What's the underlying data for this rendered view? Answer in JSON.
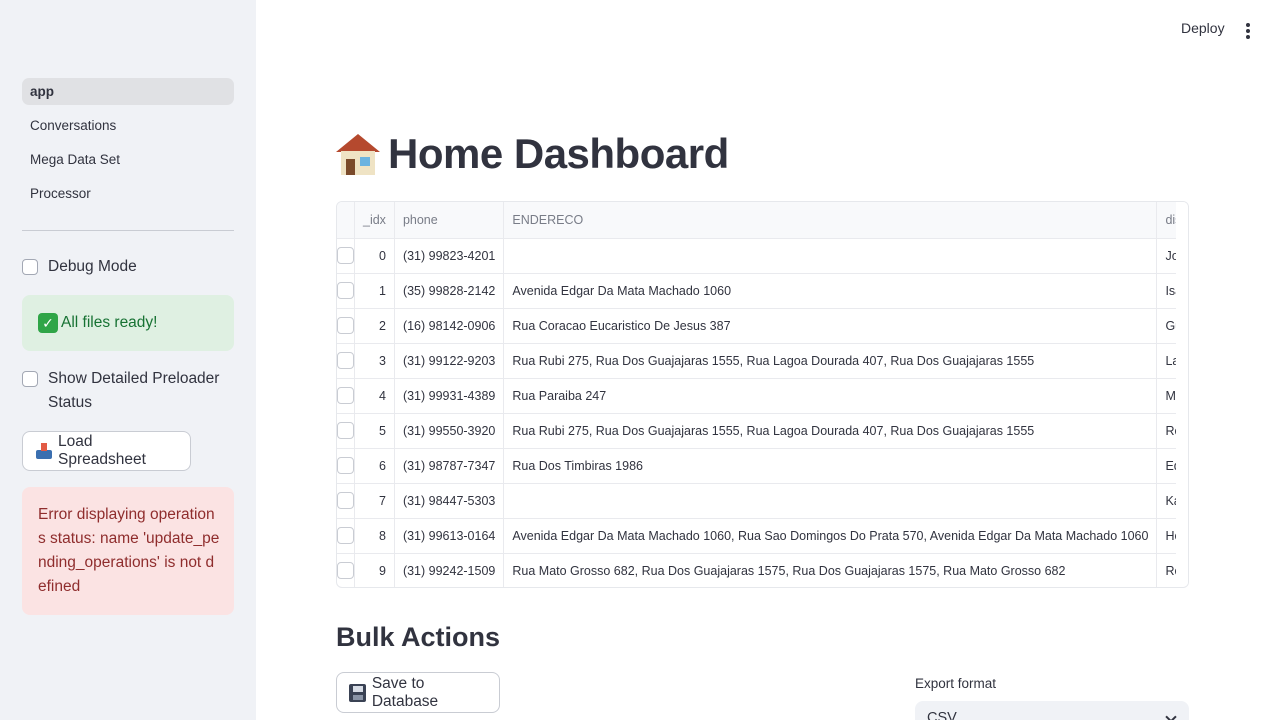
{
  "sidebar": {
    "nav": [
      {
        "label": "app",
        "active": true
      },
      {
        "label": "Conversations",
        "active": false
      },
      {
        "label": "Mega Data Set",
        "active": false
      },
      {
        "label": "Processor",
        "active": false
      }
    ],
    "debug_label": "Debug Mode",
    "success_text": "All files ready!",
    "success_icon": "check-mark-icon",
    "preloader_label": "Show Detailed Preloader Status",
    "load_button": "Load Spreadsheet",
    "load_icon": "inbox-tray-icon",
    "error_text": "Error displaying operations status: name 'update_pending_operations' is not defined"
  },
  "header": {
    "deploy": "Deploy",
    "menu_icon": "kebab-menu-icon"
  },
  "main": {
    "title": "Home Dashboard",
    "title_icon": "house-icon",
    "table": {
      "columns": [
        "_idx",
        "phone",
        "ENDERECO",
        "display_name"
      ],
      "rows": [
        {
          "idx": "0",
          "phone": "(31) 99823-4201",
          "endereco": "",
          "name": "João Ribas"
        },
        {
          "idx": "1",
          "phone": "(35) 99828-2142",
          "endereco": "Avenida Edgar Da Mata Machado 1060",
          "name": "Isabella Padua"
        },
        {
          "idx": "2",
          "phone": "(16) 98142-0906",
          "endereco": "Rua Coracao Eucaristico De Jesus 387",
          "name": "Guilherme Bustamante"
        },
        {
          "idx": "3",
          "phone": "(31) 99122-9203",
          "endereco": "Rua Rubi 275, Rua Dos Guajajaras 1555, Rua Lagoa Dourada 407, Rua Dos Guajajaras 1555",
          "name": "Laura Baldoni"
        },
        {
          "idx": "4",
          "phone": "(31) 99931-4389",
          "endereco": "Rua Paraiba 247",
          "name": "Moacir"
        },
        {
          "idx": "5",
          "phone": "(31) 99550-3920",
          "endereco": "Rua Rubi 275, Rua Dos Guajajaras 1555, Rua Lagoa Dourada 407, Rua Dos Guajajaras 1555",
          "name": "Rodrigo"
        },
        {
          "idx": "6",
          "phone": "(31) 98787-7347",
          "endereco": "Rua Dos Timbiras 1986",
          "name": "Eduardo Zauli"
        },
        {
          "idx": "7",
          "phone": "(31) 98447-5303",
          "endereco": "",
          "name": "Kassim S Raslan"
        },
        {
          "idx": "8",
          "phone": "(31) 99613-0164",
          "endereco": "Avenida Edgar Da Mata Machado 1060, Rua Sao Domingos Do Prata 570, Avenida Edgar Da Mata Machado 1060",
          "name": "Henrique Chaves"
        },
        {
          "idx": "9",
          "phone": "(31) 99242-1509",
          "endereco": "Rua Mato Grosso 682, Rua Dos Guajajaras 1575, Rua Dos Guajajaras 1575, Rua Mato Grosso 682",
          "name": "Ronaldo - Cor Imobiliária"
        }
      ]
    },
    "bulk_title": "Bulk Actions",
    "save_button": "Save to Database",
    "save_icon": "floppy-disk-icon",
    "export_label": "Export format",
    "export_value": "CSV"
  }
}
